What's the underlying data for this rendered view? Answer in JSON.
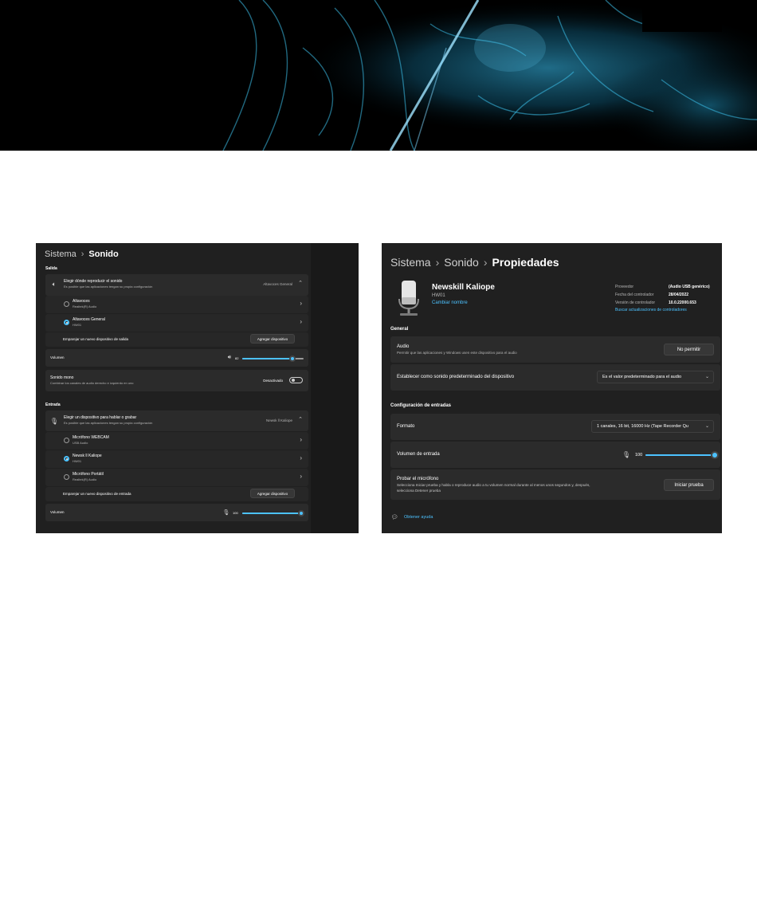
{
  "colors": {
    "accent": "#4cc2ff",
    "window_bg": "#202020",
    "card_bg": "#2b2b2b",
    "banner_glow": "#1fa9d6"
  },
  "left": {
    "breadcrumb": {
      "root": "Sistema",
      "current": "Sonido"
    },
    "output": {
      "section": "Salida",
      "header": {
        "icon": "speaker-icon",
        "title": "Elegir dónde reproducir el sonido",
        "subtitle": "Es posible que las aplicaciones tengan su propia configuración",
        "value": "Altavoces General"
      },
      "devices": [
        {
          "name": "Altavoces",
          "driver": "Realtek(R) Audio",
          "selected": false
        },
        {
          "name": "Altavoces General",
          "driver": "HW01",
          "selected": true
        }
      ],
      "pair_label": "Emparejar un nuevo dispositivo de salida",
      "add_button": "Agregar dispositivo",
      "volume_label": "Volumen",
      "volume": 82,
      "volume_display": "82",
      "mono": {
        "title": "Sonido mono",
        "subtitle": "Combinar los canales de audio derecho e izquierdo en uno",
        "state": "Desactivado"
      }
    },
    "input": {
      "section": "Entrada",
      "header": {
        "icon": "microphone-icon",
        "title": "Elegir un dispositivo para hablar o grabar",
        "subtitle": "Es posible que las aplicaciones tengan su propia configuración",
        "value": "Newsk ll Kaliope"
      },
      "devices": [
        {
          "name": "Micrófono WEBCAM",
          "driver": "USB Audio",
          "selected": false
        },
        {
          "name": "Newsk ll Kaliope",
          "driver": "HW01",
          "selected": true
        },
        {
          "name": "Micrófono Portátil",
          "driver": "Realtek(R) Audio",
          "selected": false
        }
      ],
      "pair_label": "Emparejar un nuevo dispositivo de entrada",
      "add_button": "Agregar dispositivo",
      "volume_label": "Volumen",
      "volume": 100,
      "volume_display": "100"
    }
  },
  "right": {
    "breadcrumb": {
      "root": "Sistema",
      "middle": "Sonido",
      "current": "Propiedades"
    },
    "device": {
      "icon": "microphone-icon",
      "name": "Newskill Kaliope",
      "model": "HW01",
      "rename": "Cambiar nombre",
      "provider_label": "Proveedor",
      "provider": "(Audio USB genérico)",
      "date_label": "Fecha del controlador",
      "date": "28/04/2022",
      "version_label": "Versión de controlador",
      "version": "10.0.22000.653",
      "update_link": "Buscar actualizaciones de controladores"
    },
    "general": {
      "section": "General",
      "audio_title": "Audio",
      "audio_subtitle": "Permitir que las aplicaciones y Windows usen este dispositivo para el audio",
      "audio_button": "No permitir",
      "default_label": "Establecer como sonido predeterminado del dispositivo",
      "default_value": "Es el valor predeterminado para el audio"
    },
    "inputs": {
      "section": "Configuración de entradas",
      "format_label": "Formato",
      "format_value": "1 canales, 16 bit, 16000 Hz (Tape Recorder Qu",
      "volume_label": "Volumen de entrada",
      "volume": 100,
      "volume_display": "100",
      "test_title": "Probar el micrófono",
      "test_subtitle_1": "Selecciona Iniciar prueba y habla o reproduce audio a tu volumen normal durante al menos unos segundos y, después,",
      "test_subtitle_2": "selecciona Detener prueba",
      "test_button": "Iniciar prueba"
    },
    "help": {
      "icon": "help-icon",
      "label": "Obtener ayuda"
    }
  }
}
